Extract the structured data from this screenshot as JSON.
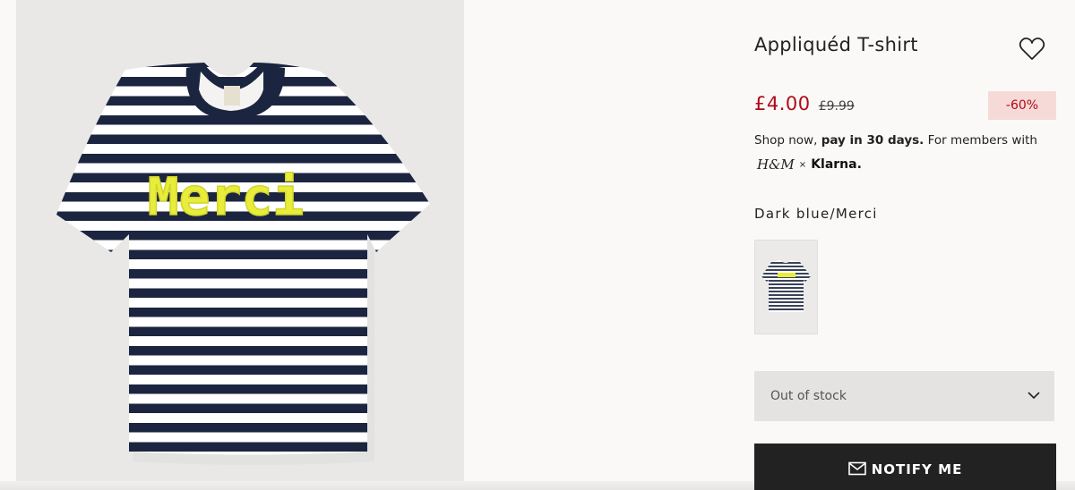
{
  "product": {
    "title": "Appliquéd T-shirt",
    "brand_label": "H&M",
    "applique_text": "Merci",
    "price_current": "£4.00",
    "price_original": "£9.99",
    "discount": "-60%"
  },
  "klarna": {
    "text_prefix": "Shop now, ",
    "text_bold": "pay in 30 days.",
    "text_suffix": " For members with",
    "hm_logo": "H&M",
    "times": "×",
    "klarna_logo": "Klarna."
  },
  "variant": {
    "color_name": "Dark blue/Merci"
  },
  "size_select": {
    "value": "Out of stock"
  },
  "actions": {
    "notify_label": "NOTIFY ME"
  },
  "icons": {
    "favourite": "heart-icon",
    "dropdown": "chevron-down-icon",
    "notify": "envelope-icon"
  },
  "colors": {
    "price_red": "#b10a16",
    "discount_bg": "#f6dad8",
    "stripe_navy": "#1c2540",
    "applique_yellow": "#e8ec3a",
    "button_dark": "#222222"
  }
}
